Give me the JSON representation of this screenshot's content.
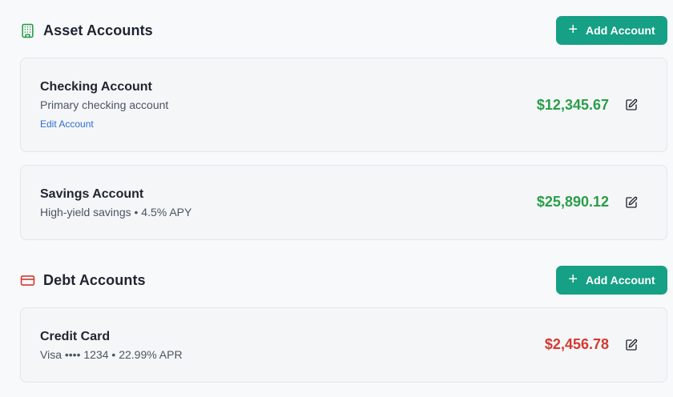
{
  "asset_section": {
    "title": "Asset Accounts",
    "icon": "building-icon",
    "icon_color": "#2a9d4a",
    "add_button": {
      "icon": "plus-icon",
      "label": "Add Account"
    },
    "accounts": [
      {
        "name": "Checking Account",
        "description": "Primary checking account",
        "edit_link": "Edit Account",
        "balance": "$12,345.67",
        "balance_color": "#2a9d4a"
      },
      {
        "name": "Savings Account",
        "description": "High-yield savings • 4.5% APY",
        "balance": "$25,890.12",
        "balance_color": "#2a9d4a"
      }
    ]
  },
  "debt_section": {
    "title": "Debt Accounts",
    "icon": "credit-card-icon",
    "icon_color": "#d23a32",
    "add_button": {
      "icon": "plus-icon",
      "label": "Add Account"
    },
    "accounts": [
      {
        "name": "Credit Card",
        "description": "Visa •••• 1234 • 22.99% APR",
        "balance": "$2,456.78",
        "balance_color": "#d23a32"
      }
    ]
  },
  "colors": {
    "accent": "#16a085",
    "background": "#f8f9fb",
    "card": "#f5f6f7",
    "link": "#2f6fd1"
  }
}
